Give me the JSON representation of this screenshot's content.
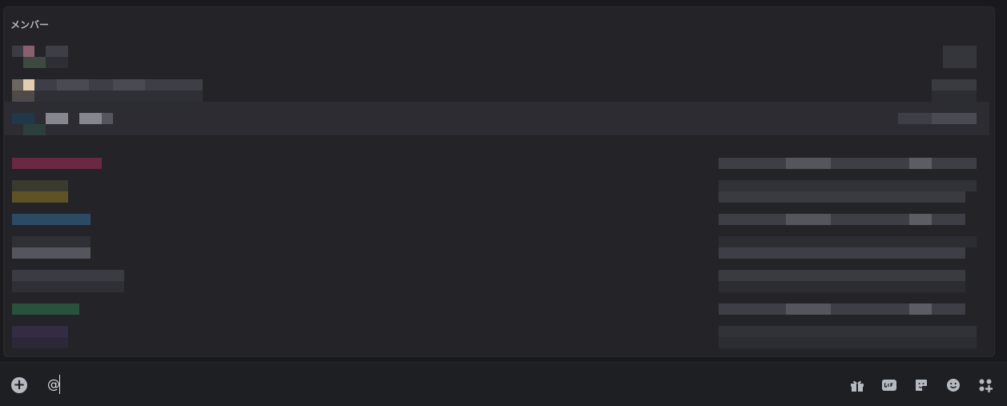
{
  "popup": {
    "title": "メンバー"
  },
  "composer": {
    "input_value": "@",
    "add_symbol": "+"
  },
  "icons": {
    "add": "plus-circle-icon",
    "gift": "gift-icon",
    "gif": "gif-icon",
    "sticker": "sticker-icon",
    "emoji": "emoji-icon",
    "apps": "apps-icon"
  }
}
